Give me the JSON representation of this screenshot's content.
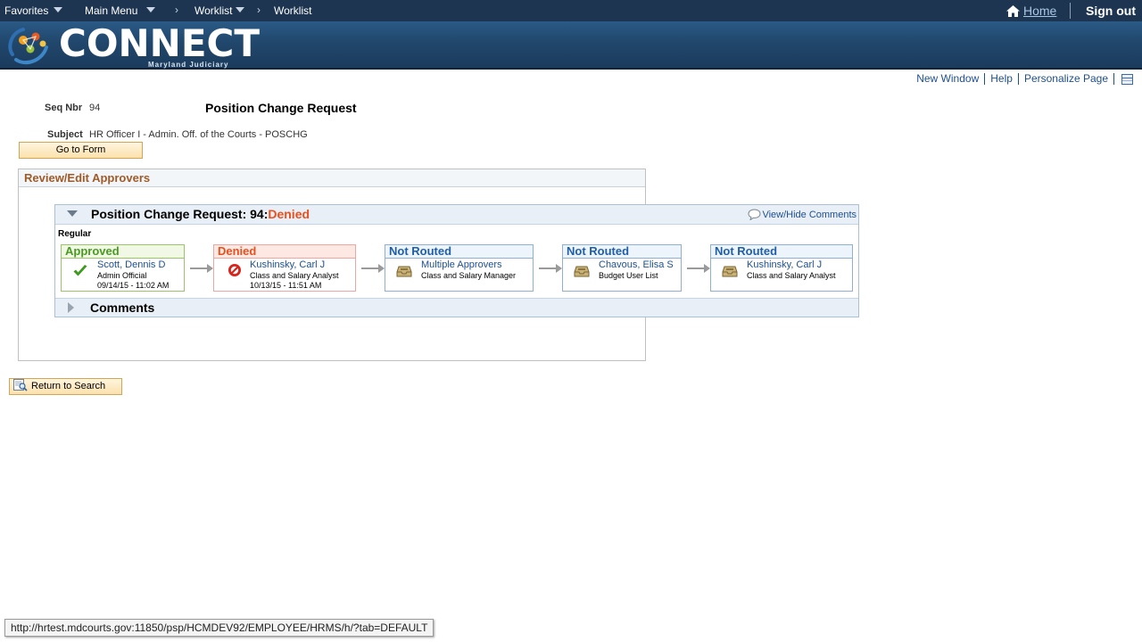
{
  "topnav": {
    "favorites": "Favorites",
    "main_menu": "Main Menu",
    "crumb1": "Worklist",
    "crumb2": "Worklist",
    "home": "Home",
    "sign_out": "Sign out"
  },
  "banner": {
    "logo_text": "CONNECT",
    "logo_subtitle": "Maryland Judiciary"
  },
  "pagelinks": {
    "new_window": "New Window",
    "help": "Help",
    "personalize": "Personalize Page"
  },
  "form": {
    "seq_label": "Seq Nbr",
    "seq_value": "94",
    "title": "Position Change Request",
    "subject_label": "Subject",
    "subject_value": "HR Officer I - Admin. Off. of the Courts - POSCHG",
    "go_to_form": "Go to Form"
  },
  "review": {
    "heading": "Review/Edit Approvers",
    "approval_title": "Position Change Request: 94:",
    "approval_status": "Denied",
    "view_hide_comments": "View/Hide Comments",
    "path_label": "Regular",
    "steps": [
      {
        "status": "Approved",
        "name": "Scott, Dennis D",
        "role": "Admin Official",
        "date": "09/14/15 - 11:02 AM"
      },
      {
        "status": "Denied",
        "name": "Kushinsky, Carl J",
        "role": "Class and Salary Analyst",
        "date": "10/13/15 - 11:51 AM"
      },
      {
        "status": "Not Routed",
        "name": "Multiple Approvers",
        "role": "Class and Salary Manager",
        "date": ""
      },
      {
        "status": "Not Routed",
        "name": "Chavous, Elisa S",
        "role": "Budget User List",
        "date": ""
      },
      {
        "status": "Not Routed",
        "name": "Kushinsky, Carl J",
        "role": "Class and Salary Analyst",
        "date": ""
      }
    ],
    "comments": "Comments"
  },
  "return_to_search": "Return to Search",
  "status_bar": "http://hrtest.mdcourts.gov:11850/psp/HCMDEV92/EMPLOYEE/HRMS/h/?tab=DEFAULT",
  "colors": {
    "nav_bg": "#1d3550",
    "approved": "#4a9a22",
    "denied": "#e8501e",
    "not_routed": "#1f5fa8",
    "link": "#1f4f8f",
    "section_heading": "#a05a28"
  }
}
